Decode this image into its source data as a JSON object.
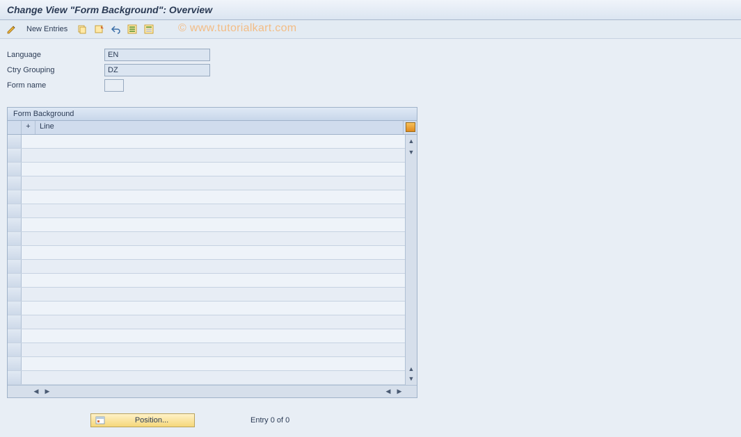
{
  "title": "Change View \"Form Background\": Overview",
  "toolbar": {
    "new_entries_label": "New Entries"
  },
  "watermark": "© www.tutorialkart.com",
  "fields": {
    "language": {
      "label": "Language",
      "value": "EN"
    },
    "ctry_grouping": {
      "label": "Ctry Grouping",
      "value": "DZ"
    },
    "form_name": {
      "label": "Form name",
      "value": ""
    }
  },
  "table": {
    "title": "Form Background",
    "col_plus": "+",
    "col_line": "Line",
    "row_count": 18
  },
  "footer": {
    "position_label": "Position...",
    "entry_text": "Entry 0 of 0"
  }
}
